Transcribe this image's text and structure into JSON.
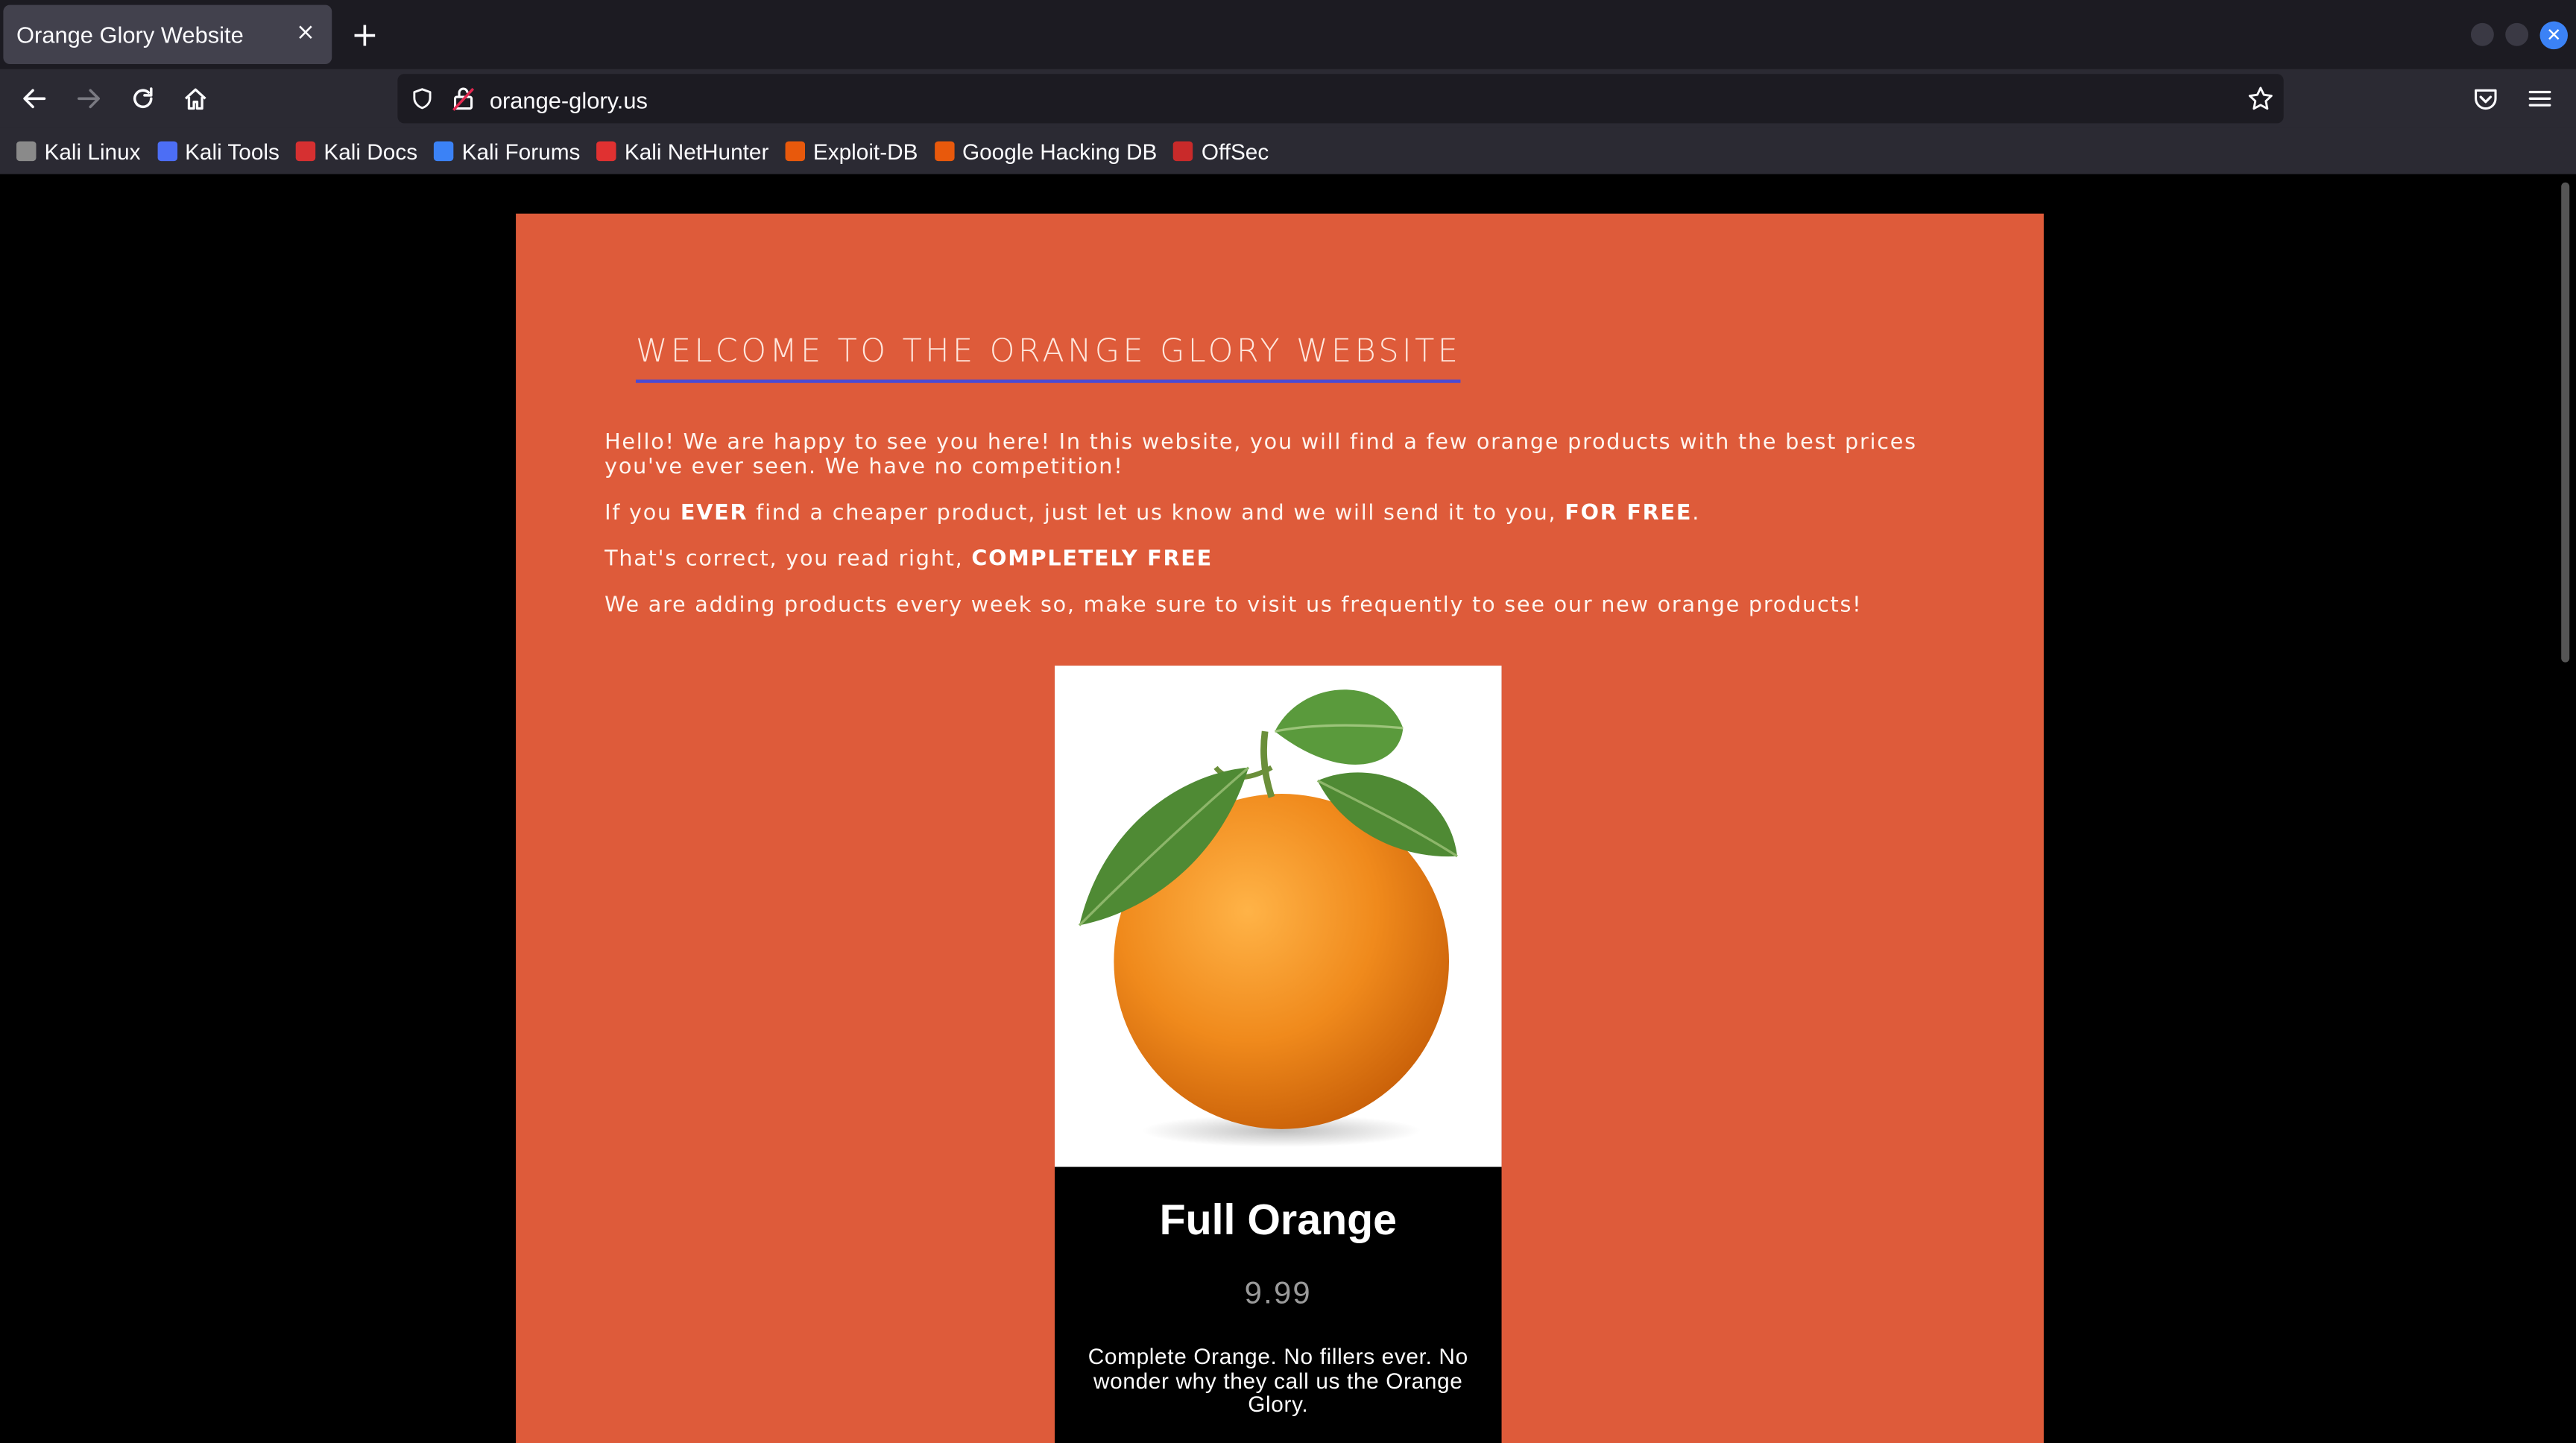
{
  "browser": {
    "tab_title": "Orange Glory Website",
    "tab_close": "×",
    "new_tab": "+",
    "url": "orange-glory.us"
  },
  "bookmarks": [
    {
      "label": "Kali Linux",
      "icon": "kali-dragon-icon",
      "color": "#8a8a8a"
    },
    {
      "label": "Kali Tools",
      "icon": "kali-tools-icon",
      "color": "#4c6ef5"
    },
    {
      "label": "Kali Docs",
      "icon": "kali-docs-icon",
      "color": "#d63031"
    },
    {
      "label": "Kali Forums",
      "icon": "kali-forums-icon",
      "color": "#3b82f6"
    },
    {
      "label": "Kali NetHunter",
      "icon": "kali-nethunter-icon",
      "color": "#e03131"
    },
    {
      "label": "Exploit-DB",
      "icon": "exploit-db-icon",
      "color": "#e8590c"
    },
    {
      "label": "Google Hacking DB",
      "icon": "ghdb-icon",
      "color": "#e8590c"
    },
    {
      "label": "OffSec",
      "icon": "offsec-icon",
      "color": "#c92a2a"
    }
  ],
  "page": {
    "headline": "WELCOME TO THE ORANGE GLORY WEBSITE",
    "para1": "Hello! We are happy to see you here! In this website, you will find a few orange products with the best prices you've ever seen. We have no competition!",
    "para2": {
      "a": "If you ",
      "b": "EVER",
      "c": " find a cheaper product, just let us know and we will send it to you, ",
      "d": "FOR FREE",
      "e": "."
    },
    "para3": {
      "a": "That's correct, you read right, ",
      "b": "COMPLETELY FREE"
    },
    "para4": "We are adding products every week so, make sure to visit us frequently to see our new orange products!"
  },
  "product": {
    "name": "Full Orange",
    "price": "9.99",
    "description": "Complete Orange. No fillers ever. No wonder why they call us the Orange Glory."
  },
  "colors": {
    "panel": "#de5b3a",
    "headline_underline": "#4a4ad6",
    "card_bg": "#000000"
  }
}
